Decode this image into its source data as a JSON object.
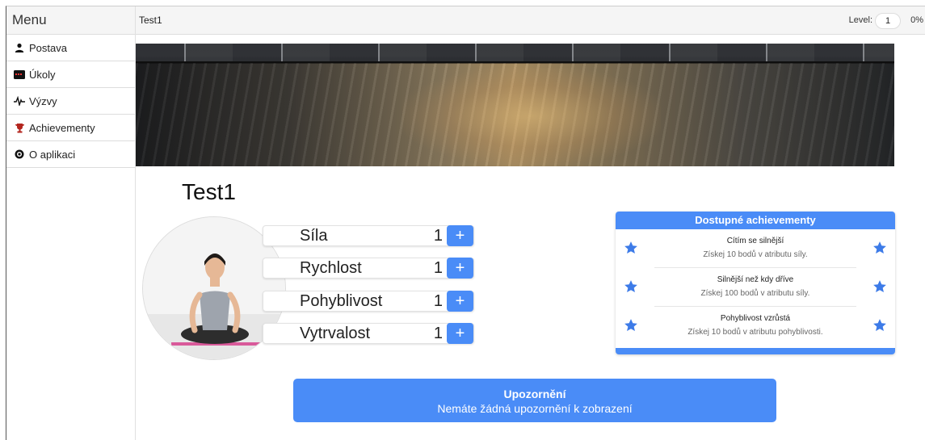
{
  "sidebar": {
    "title": "Menu",
    "items": [
      {
        "label": "Postava",
        "icon": "user-icon"
      },
      {
        "label": "Úkoly",
        "icon": "tasks-icon"
      },
      {
        "label": "Výzvy",
        "icon": "pulse-icon"
      },
      {
        "label": "Achievementy",
        "icon": "trophy-icon"
      },
      {
        "label": "O aplikaci",
        "icon": "info-icon"
      }
    ]
  },
  "topbar": {
    "title": "Test1",
    "level_label": "Level:",
    "level_value": "1",
    "progress_text": "0%"
  },
  "profile": {
    "name": "Test1",
    "stats": [
      {
        "name": "Síla",
        "value": "1"
      },
      {
        "name": "Rychlost",
        "value": "1"
      },
      {
        "name": "Pohyblivost",
        "value": "1"
      },
      {
        "name": "Vytrvalost",
        "value": "1"
      }
    ],
    "plus_symbol": "+"
  },
  "achievements": {
    "header": "Dostupné achievementy",
    "items": [
      {
        "title": "Cítím se silnější",
        "description": "Získej 10 bodů v atributu síly."
      },
      {
        "title": "Silnější než kdy dříve",
        "description": "Získej 100 bodů v atributu síly."
      },
      {
        "title": "Pohyblivost vzrůstá",
        "description": "Získej 10 bodů v atributu pohyblivosti."
      }
    ]
  },
  "notice": {
    "title": "Upozornění",
    "message": "Nemáte žádná upozornění k zobrazení"
  },
  "colors": {
    "accent": "#4a8cf7",
    "star": "#3d7be8"
  }
}
